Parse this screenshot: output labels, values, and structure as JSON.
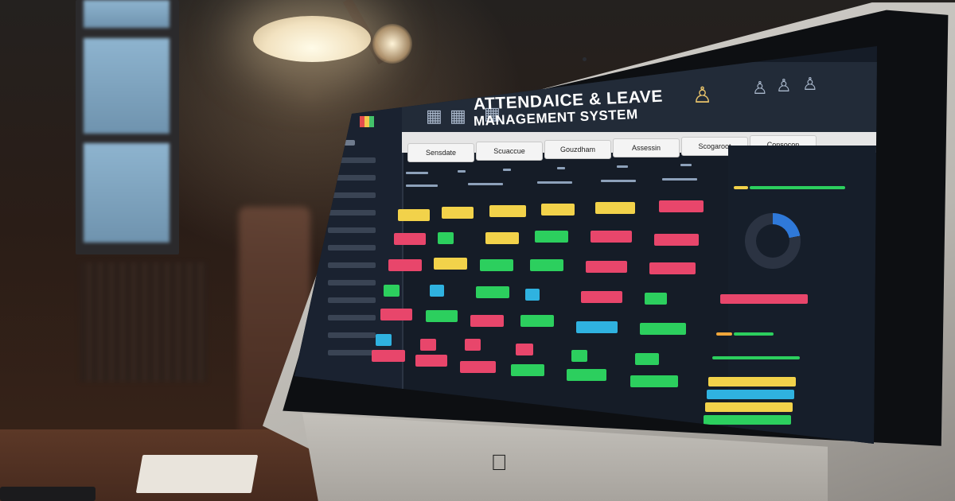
{
  "app": {
    "title_line1": "ATTENDAICE & LEAVE",
    "title_line2": "MANAGEMENT SYSTEM"
  },
  "tabs": [
    {
      "label": "Sensdate"
    },
    {
      "label": "Scuaccue"
    },
    {
      "label": "Gouzdham"
    },
    {
      "label": "Assessin"
    },
    {
      "label": "Scogaroot"
    },
    {
      "label": "Consocon"
    }
  ],
  "icons": {
    "monitor_logo": "apple-icon",
    "top_left": "grid-icon",
    "top_right_group": "people-icon",
    "top_right_users": "users-icon"
  },
  "colors": {
    "screen_bg": "#151c27",
    "yellow": "#f2d24a",
    "red": "#e8466b",
    "green": "#2ccf5e",
    "blue": "#2fb2e0"
  }
}
